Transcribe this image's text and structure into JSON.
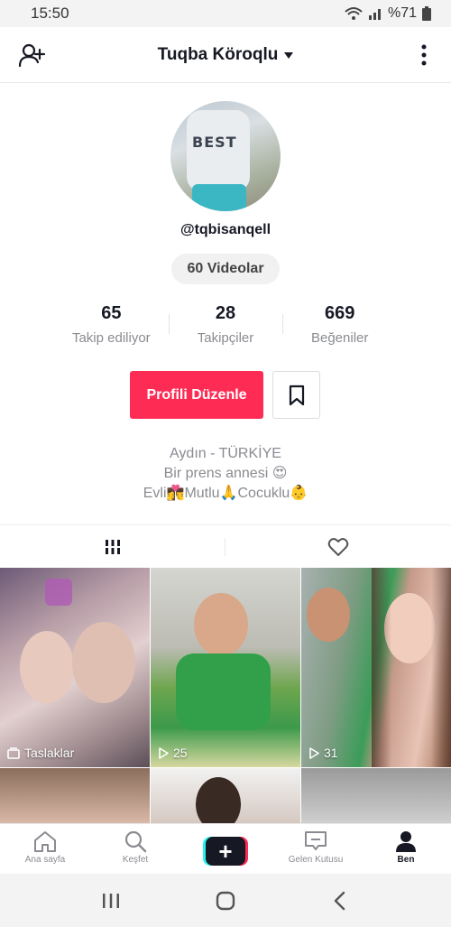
{
  "status_bar": {
    "time": "15:50",
    "battery": "%71"
  },
  "header": {
    "username": "Tuqba Köroqlu"
  },
  "profile": {
    "handle": "@tqbisanqell",
    "videos_pill": "60 Videolar",
    "stats": [
      {
        "value": "65",
        "label": "Takip ediliyor"
      },
      {
        "value": "28",
        "label": "Takipçiler"
      },
      {
        "value": "669",
        "label": "Beğeniler"
      }
    ],
    "edit_button": "Profili Düzenle",
    "bio": [
      "Aydın - TÜRKİYE",
      "Bir prens annesi 😍",
      "Evli👩‍❤️‍💋‍👨Mutlu🙏Cocuklu👶"
    ]
  },
  "grid": {
    "tiles": [
      {
        "caption": "Taslaklar",
        "icon": "drafts-icon"
      },
      {
        "caption": "25",
        "icon": "play-icon"
      },
      {
        "caption": "31",
        "icon": "play-icon"
      }
    ]
  },
  "bottom_nav": [
    {
      "label": "Ana sayfa",
      "icon": "home-icon"
    },
    {
      "label": "Keşfet",
      "icon": "search-icon"
    },
    {
      "label": "",
      "icon": "create-icon"
    },
    {
      "label": "Gelen Kutusu",
      "icon": "inbox-icon"
    },
    {
      "label": "Ben",
      "icon": "profile-icon"
    }
  ],
  "colors": {
    "accent": "#fe2c55",
    "text": "#161823",
    "muted": "#8a8b91"
  }
}
